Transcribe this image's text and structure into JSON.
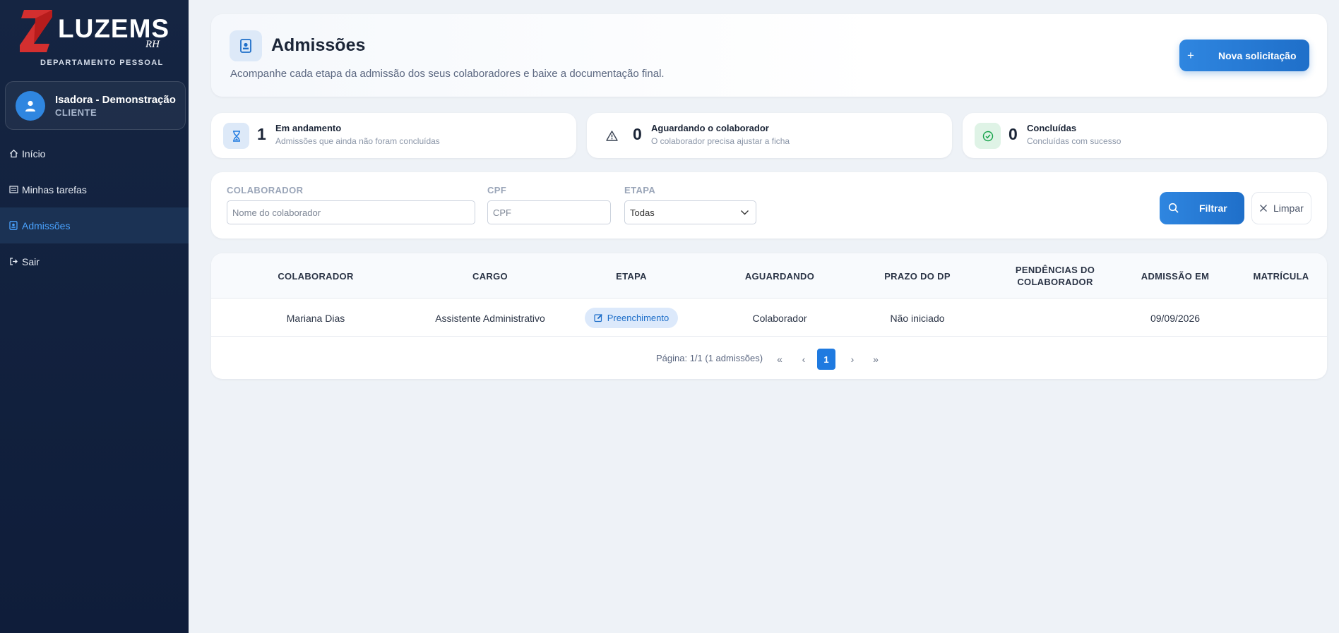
{
  "brand": {
    "name": "LUZEMS",
    "suffix": "RH",
    "subtitle": "DEPARTAMENTO PESSOAL",
    "accent": "#e53935"
  },
  "user": {
    "name": "Isadora - Demonstração",
    "role": "CLIENTE"
  },
  "nav": {
    "items": [
      {
        "label": "Início",
        "icon": "home-icon"
      },
      {
        "label": "Minhas tarefas",
        "icon": "list-icon"
      },
      {
        "label": "Admissões",
        "icon": "id-badge-icon",
        "active": true
      },
      {
        "label": "Sair",
        "icon": "logout-icon"
      }
    ]
  },
  "header": {
    "title": "Admissões",
    "description": "Acompanhe cada etapa da admissão dos seus colaboradores e baixe a documentação final.",
    "new_button": "Nova solicitação"
  },
  "stats": [
    {
      "value": "1",
      "title": "Em andamento",
      "subtitle": "Admissões que ainda não foram concluídas",
      "icon": "hourglass-icon",
      "color": "#1f7ae0"
    },
    {
      "value": "0",
      "title": "Aguardando o colaborador",
      "subtitle": "O colaborador precisa ajustar a ficha",
      "icon": "warning-icon",
      "color": "#374151"
    },
    {
      "value": "0",
      "title": "Concluídas",
      "subtitle": "Concluídas com sucesso",
      "icon": "check-circle-icon",
      "color": "#16a34a"
    }
  ],
  "filters": {
    "collaborator": {
      "label": "COLABORADOR",
      "placeholder": "Nome do colaborador",
      "value": ""
    },
    "cpf": {
      "label": "CPF",
      "placeholder": "CPF",
      "value": ""
    },
    "stage": {
      "label": "ETAPA",
      "value": "Todas"
    },
    "filter_button": "Filtrar",
    "clear_button": "Limpar"
  },
  "table": {
    "columns": [
      "COLABORADOR",
      "CARGO",
      "ETAPA",
      "AGUARDANDO",
      "PRAZO DO DP",
      "PENDÊNCIAS DO COLABORADOR",
      "ADMISSÃO EM",
      "MATRÍCULA"
    ],
    "rows": [
      {
        "colaborador": "Mariana Dias",
        "cargo": "Assistente Administrativo",
        "etapa": "Preenchimento",
        "aguardando": "Colaborador",
        "prazo": "Não iniciado",
        "pendencias": "",
        "admissao": "09/09/2026",
        "matricula": ""
      }
    ]
  },
  "pagination": {
    "info": "Página: 1/1 (1 admissões)",
    "current": "1",
    "first": "«",
    "prev": "‹",
    "next": "›",
    "last": "»"
  }
}
